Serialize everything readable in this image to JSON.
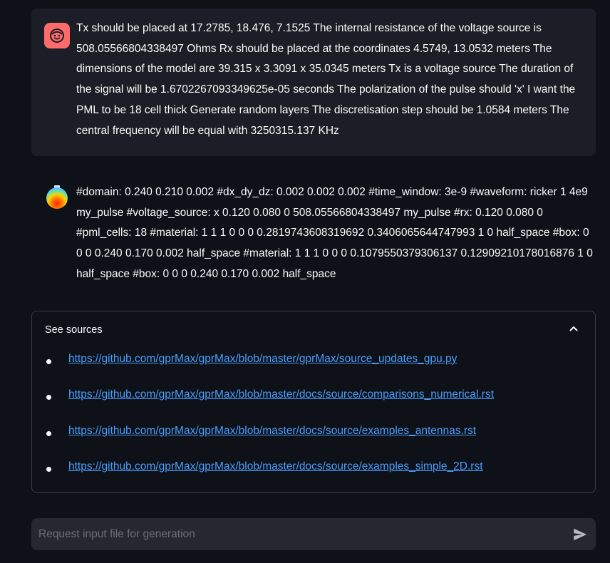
{
  "messages": [
    {
      "role": "user",
      "avatar_icon": "smiley-face-icon",
      "text": "Tx should be placed at 17.2785, 18.476, 7.1525 The internal resistance of the voltage source is 508.05566804338497 Ohms Rx should be placed at the coordinates 4.5749, 13.0532 meters The dimensions of the model are 39.315 x 3.3091 x 35.0345 meters Tx is a voltage source The duration of the signal will be 1.6702267093349625e-05 seconds The polarization of the pulse should 'x' I want the PML to be 18 cell thick Generate random layers The discretisation step should be 1.0584 meters The central frequency will be equal with 3250315.137 KHz"
    },
    {
      "role": "assistant",
      "avatar_icon": "gradient-orb-icon",
      "text": "#domain: 0.240 0.210 0.002 #dx_dy_dz: 0.002 0.002 0.002 #time_window: 3e-9 #waveform: ricker 1 4e9 my_pulse #voltage_source: x 0.120 0.080 0 508.05566804338497 my_pulse #rx: 0.120 0.080 0 #pml_cells: 18 #material: 1 1 1 0 0 0 0.2819743608319692 0.3406065644747993 1 0 half_space #box: 0 0 0 0.240 0.170 0.002 half_space #material: 1 1 1 0 0 0 0.1079550379306137 0.12909210178016876 1 0 half_space #box: 0 0 0 0.240 0.170 0.002 half_space"
    }
  ],
  "sources": {
    "header": "See sources",
    "expanded": true,
    "links": [
      "https://github.com/gprMax/gprMax/blob/master/gprMax/source_updates_gpu.py",
      "https://github.com/gprMax/gprMax/blob/master/docs/source/comparisons_numerical.rst",
      "https://github.com/gprMax/gprMax/blob/master/docs/source/examples_antennas.rst",
      "https://github.com/gprMax/gprMax/blob/master/docs/source/examples_simple_2D.rst"
    ]
  },
  "chat_input": {
    "placeholder": "Request input file for generation",
    "value": ""
  },
  "colors": {
    "background": "#0e1117",
    "user_bubble": "#1b1e26",
    "user_avatar": "#ff6b6b",
    "link": "#4a9eff",
    "input_bg": "#262730"
  }
}
